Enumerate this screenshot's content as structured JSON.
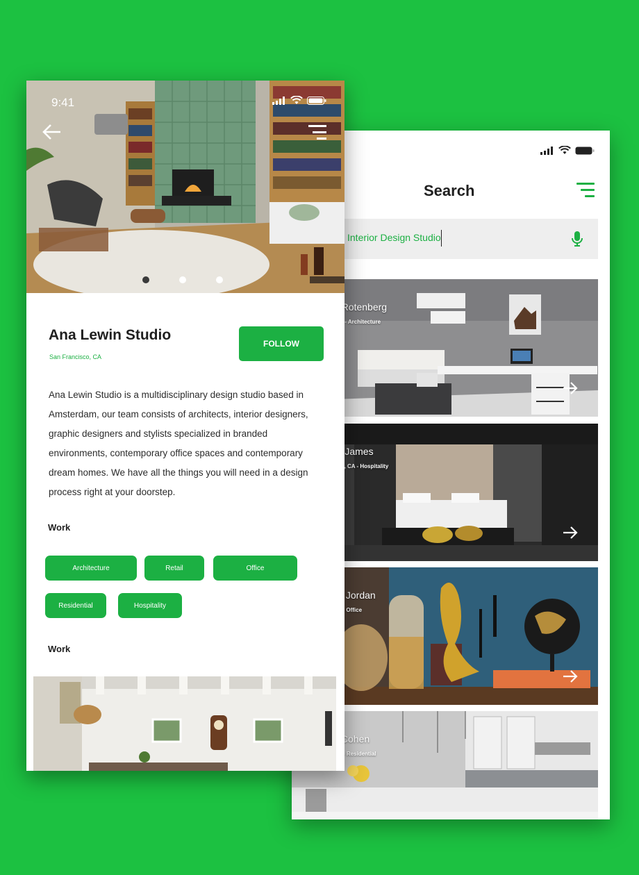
{
  "colors": {
    "accent": "#1cb043",
    "background": "#1cc141"
  },
  "search_screen": {
    "title": "Search",
    "search_value": "Interior Design Studio",
    "cards": [
      {
        "name": "a Rotenberg",
        "subtitle": ", FL - Architecture"
      },
      {
        "name": "ra James",
        "subtitle": "eles, CA - Hospitality"
      },
      {
        "name": "iel Jordan",
        "subtitle": "CA - Office"
      },
      {
        "name": "s Cohen",
        "subtitle": "GA - Residential"
      }
    ]
  },
  "profile_screen": {
    "time": "9:41",
    "studio_name": "Ana Lewin Studio",
    "location": "San Francisco, CA",
    "follow_label": "FOLLOW",
    "description": "Ana Lewin Studio is a multidisciplinary design studio based in Amsterdam, our team consists of architects, interior designers, graphic designers and stylists specialized in branded environments, contemporary office spaces and contemporary dream homes. We have all the things you will need in a design process right at your doorstep.",
    "section_work_1": "Work",
    "section_work_2": "Work",
    "tags": [
      "Architecture",
      "Retail",
      "Office",
      "Residential",
      "Hospitality"
    ]
  }
}
